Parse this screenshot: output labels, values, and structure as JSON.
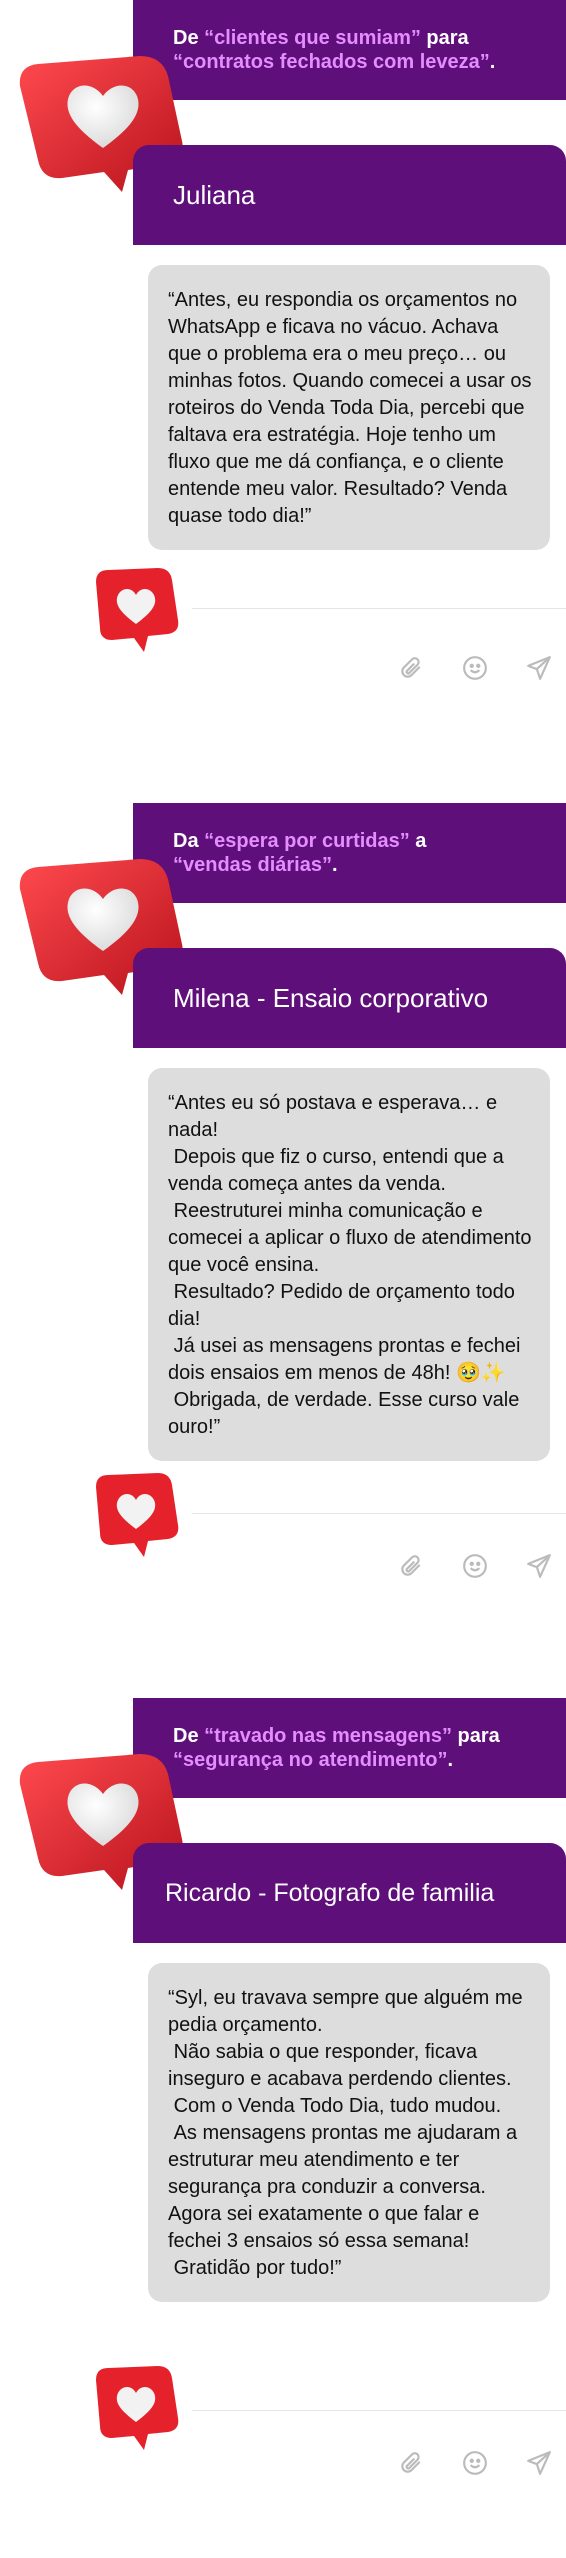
{
  "testimonials": [
    {
      "headline": {
        "part1": "De ",
        "highlight1": "“clientes que sumiam”",
        "part2": " para ",
        "highlight2": "“contratos fechados com leveza”",
        "part3": "."
      },
      "name": "Juliana",
      "quote": "“Antes, eu respondia os orçamentos no WhatsApp e ficava no vácuo. Achava que o problema era o meu preço… ou minhas fotos. Quando comecei a usar os roteiros do Venda Toda Dia, percebi que faltava era estratégia. Hoje tenho um fluxo que me dá confiança, e o cliente entende meu valor. Resultado? Venda quase todo dia!”"
    },
    {
      "headline": {
        "part1": "Da ",
        "highlight1": "“espera por curtidas”",
        "part2": " a ",
        "highlight2": "“vendas diárias”",
        "part3": "."
      },
      "name": "Milena - Ensaio corporativo",
      "quote": "“Antes eu só postava e esperava… e nada!\n Depois que fiz o curso, entendi que a venda começa antes da venda.\n Reestruturei minha comunicação e comecei a aplicar o fluxo de atendimento que você ensina.\n Resultado? Pedido de orçamento todo dia!\n Já usei as mensagens prontas e fechei dois ensaios em menos de 48h! 🥹✨\n Obrigada, de verdade. Esse curso vale ouro!”"
    },
    {
      "headline": {
        "part1": "De ",
        "highlight1": "“travado nas mensagens”",
        "part2": " para ",
        "highlight2": "“segurança no atendimento”",
        "part3": "."
      },
      "name": "Ricardo - Fotografo de familia",
      "quote": "“Syl, eu travava sempre que alguém me pedia orçamento.\n Não sabia o que responder, ficava inseguro e acabava perdendo clientes.\n Com o Venda Todo Dia, tudo mudou.\n As mensagens prontas me ajudaram a estruturar meu atendimento e ter segurança pra conduzir a conversa. Agora sei exatamente o que falar e fechei 3 ensaios só essa semana!\n Gratidão por tudo!”"
    }
  ],
  "icons": [
    "paperclip-icon",
    "emoji-icon",
    "send-icon"
  ],
  "colors": {
    "purple": "#5f0f7a",
    "highlight": "#e58cff",
    "bubble": "#dddddd",
    "heart_red": "#e5222b"
  }
}
